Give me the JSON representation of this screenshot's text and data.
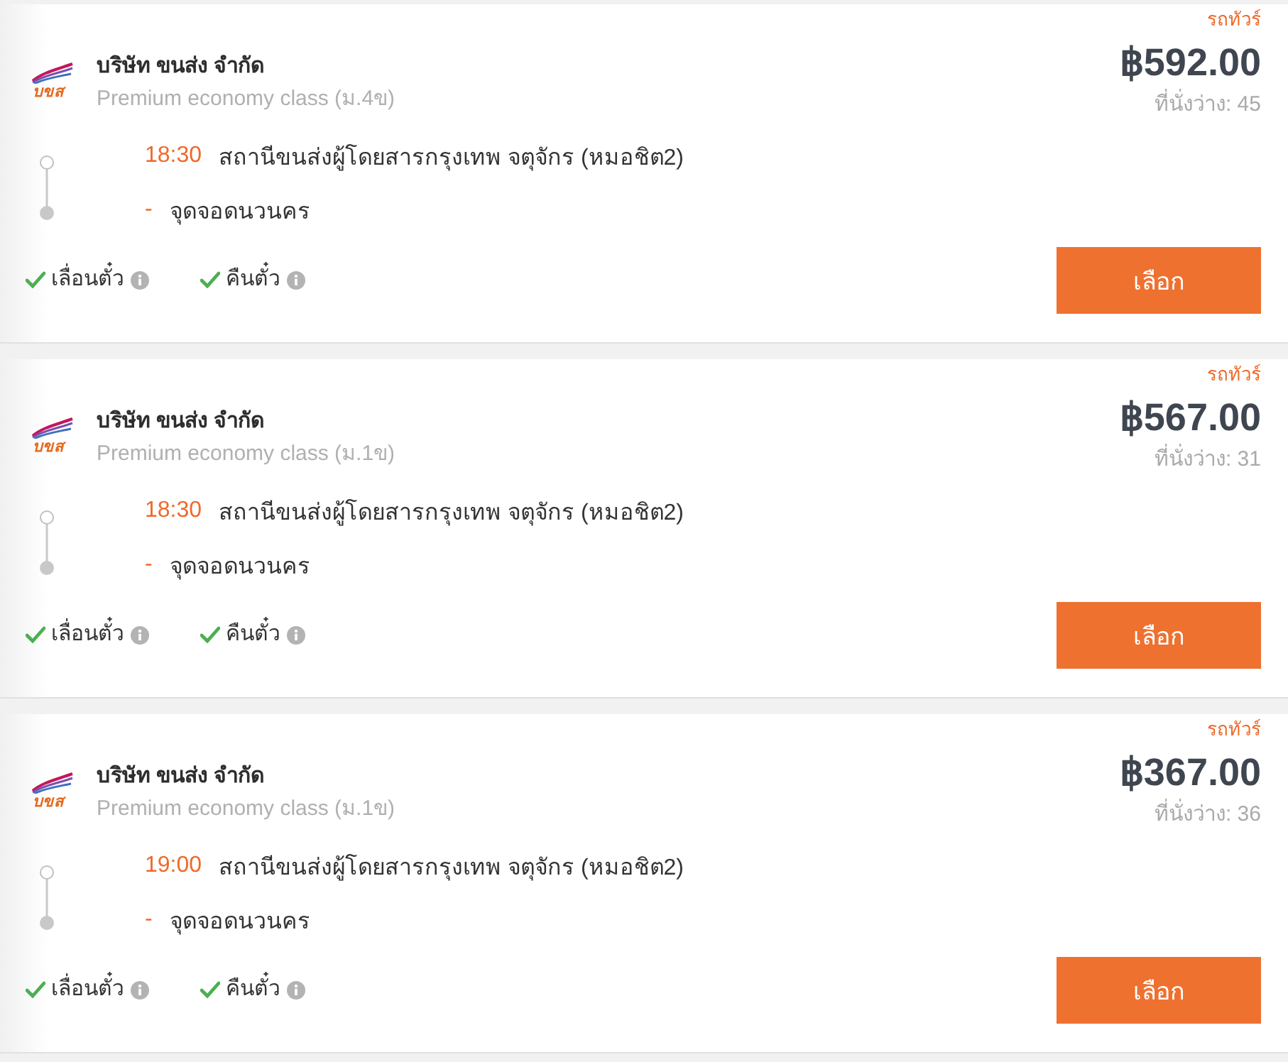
{
  "trips": [
    {
      "tag": "รถทัวร์",
      "logo_text": "บขส",
      "operator": "บริษัท ขนส่ง จำกัด",
      "class": "Premium economy class (ม.4ข)",
      "price": "฿592.00",
      "seats": "ที่นั่งว่าง: 45",
      "departure": {
        "time": "18:30",
        "station": "สถานีขนส่งผู้โดยสารกรุงเทพ จตุจักร (หมอชิต2)"
      },
      "arrival": {
        "time": "-",
        "station": "จุดจอดนวนคร"
      },
      "policies": [
        {
          "label": "เลื่อนตั๋ว",
          "allowed": true
        },
        {
          "label": "คืนตั๋ว",
          "allowed": true
        }
      ],
      "button": "เลือก"
    },
    {
      "tag": "รถทัวร์",
      "logo_text": "บขส",
      "operator": "บริษัท ขนส่ง จำกัด",
      "class": "Premium economy class (ม.1ข)",
      "price": "฿567.00",
      "seats": "ที่นั่งว่าง: 31",
      "departure": {
        "time": "18:30",
        "station": "สถานีขนส่งผู้โดยสารกรุงเทพ จตุจักร (หมอชิต2)"
      },
      "arrival": {
        "time": "-",
        "station": "จุดจอดนวนคร"
      },
      "policies": [
        {
          "label": "เลื่อนตั๋ว",
          "allowed": true
        },
        {
          "label": "คืนตั๋ว",
          "allowed": true
        }
      ],
      "button": "เลือก"
    },
    {
      "tag": "รถทัวร์",
      "logo_text": "บขส",
      "operator": "บริษัท ขนส่ง จำกัด",
      "class": "Premium economy class (ม.1ข)",
      "price": "฿367.00",
      "seats": "ที่นั่งว่าง: 36",
      "departure": {
        "time": "19:00",
        "station": "สถานีขนส่งผู้โดยสารกรุงเทพ จตุจักร (หมอชิต2)"
      },
      "arrival": {
        "time": "-",
        "station": "จุดจอดนวนคร"
      },
      "policies": [
        {
          "label": "เลื่อนตั๋ว",
          "allowed": true
        },
        {
          "label": "คืนตั๋ว",
          "allowed": true
        }
      ],
      "button": "เลือก"
    }
  ]
}
